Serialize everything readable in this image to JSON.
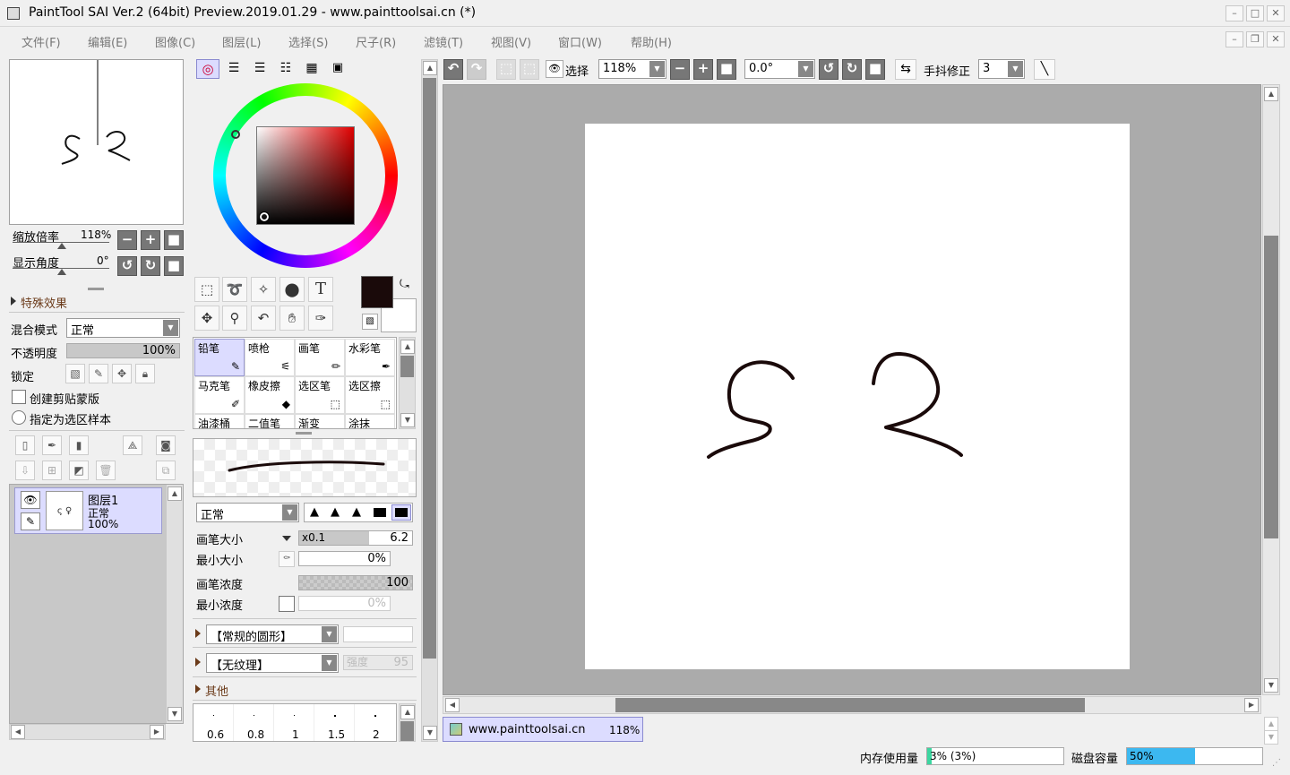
{
  "window": {
    "title": "PaintTool SAI Ver.2 (64bit) Preview.2019.01.29 - www.painttoolsai.cn (*)"
  },
  "menu": [
    "文件(F)",
    "编辑(E)",
    "图像(C)",
    "图层(L)",
    "选择(S)",
    "尺子(R)",
    "滤镜(T)",
    "视图(V)",
    "窗口(W)",
    "帮助(H)"
  ],
  "navigator": {
    "zoom_label": "缩放倍率",
    "zoom_value": "118%",
    "angle_label": "显示角度",
    "angle_value": "0°"
  },
  "layer_props": {
    "effects_label": "特殊效果",
    "blend_label": "混合模式",
    "blend_value": "正常",
    "opacity_label": "不透明度",
    "opacity_value": "100%",
    "lock_label": "锁定",
    "clip_label": "创建剪贴蒙版",
    "sample_label": "指定为选区样本"
  },
  "layers": [
    {
      "name": "图层1",
      "mode": "正常",
      "opacity": "100%"
    }
  ],
  "brushes": [
    {
      "name": "铅笔",
      "selected": true
    },
    {
      "name": "喷枪"
    },
    {
      "name": "画笔"
    },
    {
      "name": "水彩笔"
    },
    {
      "name": "马克笔"
    },
    {
      "name": "橡皮擦"
    },
    {
      "name": "选区笔"
    },
    {
      "name": "选区擦"
    },
    {
      "name": "油漆桶"
    },
    {
      "name": "二值笔"
    },
    {
      "name": "渐变"
    },
    {
      "name": "涂抹"
    }
  ],
  "brush_settings": {
    "blend_value": "正常",
    "size_label": "画笔大小",
    "size_mult": "x0.1",
    "size_value": "6.2",
    "minsize_label": "最小大小",
    "minsize_value": "0%",
    "density_label": "画笔浓度",
    "density_value": "100",
    "mindensity_label": "最小浓度",
    "mindensity_value": "0%",
    "shape_value": "【常规的圆形】",
    "texture_value": "【无纹理】",
    "strength_label": "强度",
    "strength_value": "95",
    "other_label": "其他",
    "presets": [
      "0.6",
      "0.8",
      "1",
      "1.5",
      "2"
    ]
  },
  "toolbar": {
    "select_label": "选择",
    "zoom_value": "118%",
    "angle_value": "0.0°",
    "stabilizer_label": "手抖修正",
    "stabilizer_value": "3"
  },
  "doc_tab": {
    "name": "www.painttoolsai.cn",
    "zoom": "118%"
  },
  "status": {
    "memory_label": "内存使用量",
    "memory_value": "3% (3%)",
    "memory_fraction": 0.03,
    "disk_label": "磁盘容量",
    "disk_value": "50%",
    "disk_fraction": 0.5
  },
  "colors": {
    "primary": "#1a0a0a",
    "secondary": "#ffffff",
    "accent": "#dcdcff",
    "canvas_bg": "#ababab"
  }
}
